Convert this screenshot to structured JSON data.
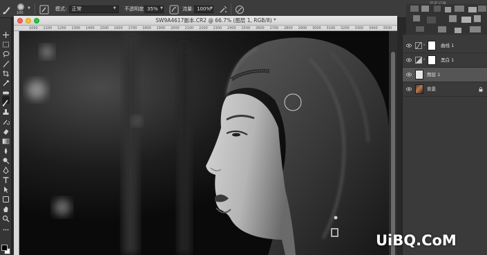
{
  "options_bar": {
    "brush_size": "100",
    "mode_label": "模式:",
    "mode_value": "正常",
    "opacity_label": "不透明度:",
    "opacity_value": "35%",
    "flow_label": "流量:",
    "flow_value": "100%"
  },
  "history_panel": {
    "title": "历史记录"
  },
  "document": {
    "title": "SW9A4617副本.CR2 @ 66.7% (图层 1, RGB/8) *",
    "ruler_ticks": [
      "1000",
      "1100",
      "1200",
      "1300",
      "1400",
      "1500",
      "1600",
      "1700",
      "1800",
      "1900",
      "2000",
      "2100",
      "2200",
      "2300",
      "2400",
      "2500",
      "2600",
      "2700",
      "2800",
      "2900",
      "3000",
      "3100",
      "3200",
      "3300",
      "3400",
      "3500"
    ]
  },
  "layers": [
    {
      "name": "曲线 1",
      "kind": "adjustment",
      "adjustment_icon": "curves-icon",
      "selected": false
    },
    {
      "name": "黑白 1",
      "kind": "adjustment",
      "adjustment_icon": "black-white-icon",
      "selected": false
    },
    {
      "name": "图层 1",
      "kind": "pixel",
      "selected": true
    },
    {
      "name": "背景",
      "kind": "background",
      "locked": true,
      "selected": false
    }
  ],
  "watermark": {
    "text": "UiBQ.CoM"
  },
  "colors": {
    "workspace": "#282828",
    "panel": "#3a3a3a",
    "selected_layer": "#555555",
    "title_bar": "#dcdcdc",
    "foreground_swatch": "#000000",
    "background_swatch": "#ffffff"
  },
  "icons": [
    "brush-icon",
    "brush-preset-icon",
    "airbrush-icon",
    "pressure-opacity-icon",
    "pressure-size-icon",
    "eye-icon",
    "lock-icon",
    "move-icon",
    "marquee-icon",
    "lasso-icon",
    "magic-wand-icon",
    "crop-icon",
    "eyedropper-icon",
    "healing-icon",
    "brush-tool-icon",
    "clone-stamp-icon",
    "history-brush-icon",
    "eraser-icon",
    "gradient-icon",
    "blur-icon",
    "dodge-icon",
    "pen-icon",
    "type-icon",
    "path-select-icon",
    "shape-icon",
    "hand-icon",
    "zoom-icon"
  ]
}
